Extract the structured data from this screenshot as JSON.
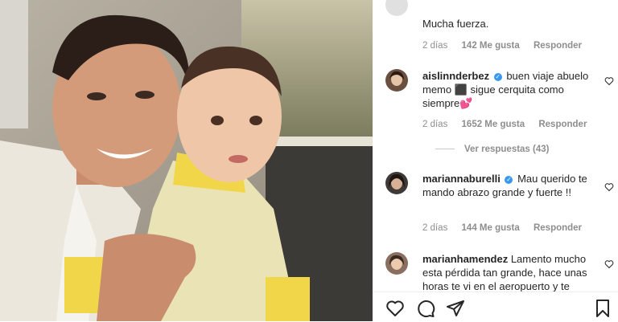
{
  "post": {
    "photo_alt": ""
  },
  "comments": [
    {
      "username": "",
      "text": "Mucha fuerza.",
      "time": "2 días",
      "likes": "142 Me gusta",
      "reply": "Responder"
    },
    {
      "username": "aislinnderbez",
      "text": "buen viaje abuelo memo ⬛ sigue cerquita como siempre💕",
      "time": "2 días",
      "likes": "1652 Me gusta",
      "reply": "Responder",
      "view_replies": "Ver respuestas (43)"
    },
    {
      "username": "mariannaburelli",
      "text": "Mau querido te mando abrazo grande y fuerte !!",
      "time": "2 días",
      "likes": "144 Me gusta",
      "reply": "Responder"
    },
    {
      "username": "marianhamendez",
      "text": "Lamento mucho esta pérdida tan grande, hace unas horas te vi en el aeropuerto y te"
    }
  ],
  "icons": {
    "like": "heart-icon",
    "comment": "comment-icon",
    "share": "share-icon",
    "save": "bookmark-icon"
  },
  "colors": {
    "verified": "#3897f0",
    "meta": "#8e8e8e"
  }
}
